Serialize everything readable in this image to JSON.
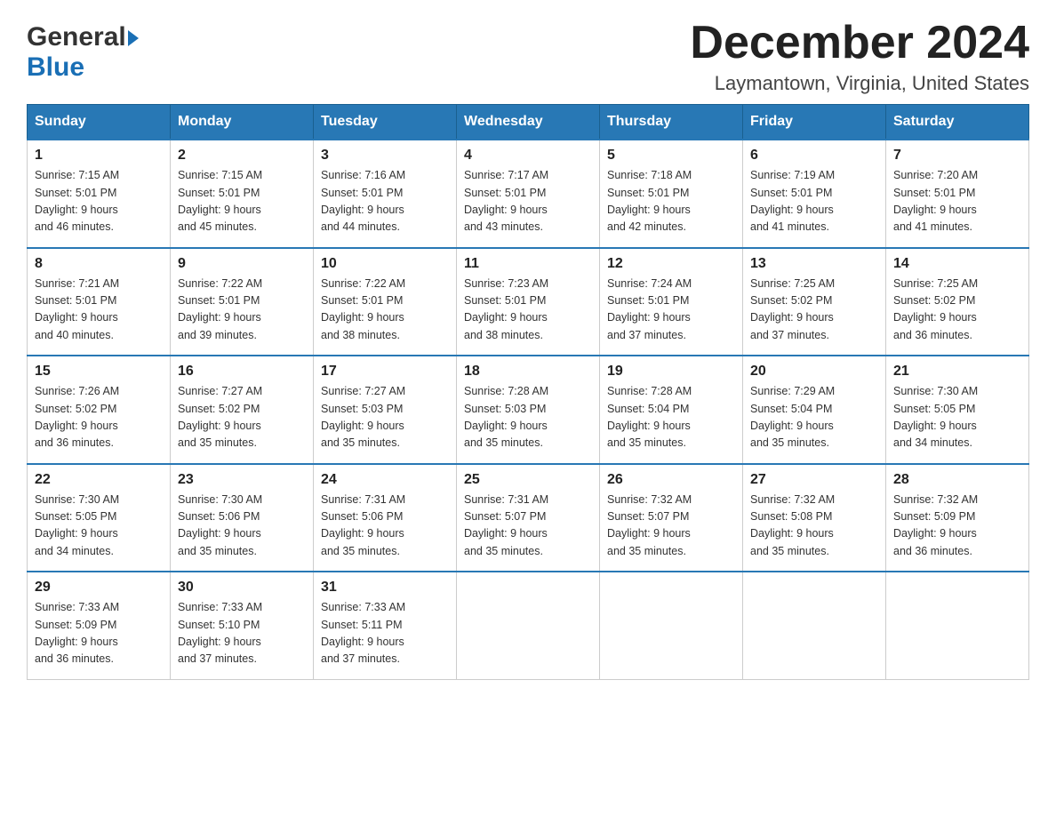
{
  "header": {
    "logo_general": "General",
    "logo_blue": "Blue",
    "month_title": "December 2024",
    "location": "Laymantown, Virginia, United States"
  },
  "days_of_week": [
    "Sunday",
    "Monday",
    "Tuesday",
    "Wednesday",
    "Thursday",
    "Friday",
    "Saturday"
  ],
  "weeks": [
    [
      {
        "day": "1",
        "sunrise": "7:15 AM",
        "sunset": "5:01 PM",
        "daylight": "9 hours and 46 minutes."
      },
      {
        "day": "2",
        "sunrise": "7:15 AM",
        "sunset": "5:01 PM",
        "daylight": "9 hours and 45 minutes."
      },
      {
        "day": "3",
        "sunrise": "7:16 AM",
        "sunset": "5:01 PM",
        "daylight": "9 hours and 44 minutes."
      },
      {
        "day": "4",
        "sunrise": "7:17 AM",
        "sunset": "5:01 PM",
        "daylight": "9 hours and 43 minutes."
      },
      {
        "day": "5",
        "sunrise": "7:18 AM",
        "sunset": "5:01 PM",
        "daylight": "9 hours and 42 minutes."
      },
      {
        "day": "6",
        "sunrise": "7:19 AM",
        "sunset": "5:01 PM",
        "daylight": "9 hours and 41 minutes."
      },
      {
        "day": "7",
        "sunrise": "7:20 AM",
        "sunset": "5:01 PM",
        "daylight": "9 hours and 41 minutes."
      }
    ],
    [
      {
        "day": "8",
        "sunrise": "7:21 AM",
        "sunset": "5:01 PM",
        "daylight": "9 hours and 40 minutes."
      },
      {
        "day": "9",
        "sunrise": "7:22 AM",
        "sunset": "5:01 PM",
        "daylight": "9 hours and 39 minutes."
      },
      {
        "day": "10",
        "sunrise": "7:22 AM",
        "sunset": "5:01 PM",
        "daylight": "9 hours and 38 minutes."
      },
      {
        "day": "11",
        "sunrise": "7:23 AM",
        "sunset": "5:01 PM",
        "daylight": "9 hours and 38 minutes."
      },
      {
        "day": "12",
        "sunrise": "7:24 AM",
        "sunset": "5:01 PM",
        "daylight": "9 hours and 37 minutes."
      },
      {
        "day": "13",
        "sunrise": "7:25 AM",
        "sunset": "5:02 PM",
        "daylight": "9 hours and 37 minutes."
      },
      {
        "day": "14",
        "sunrise": "7:25 AM",
        "sunset": "5:02 PM",
        "daylight": "9 hours and 36 minutes."
      }
    ],
    [
      {
        "day": "15",
        "sunrise": "7:26 AM",
        "sunset": "5:02 PM",
        "daylight": "9 hours and 36 minutes."
      },
      {
        "day": "16",
        "sunrise": "7:27 AM",
        "sunset": "5:02 PM",
        "daylight": "9 hours and 35 minutes."
      },
      {
        "day": "17",
        "sunrise": "7:27 AM",
        "sunset": "5:03 PM",
        "daylight": "9 hours and 35 minutes."
      },
      {
        "day": "18",
        "sunrise": "7:28 AM",
        "sunset": "5:03 PM",
        "daylight": "9 hours and 35 minutes."
      },
      {
        "day": "19",
        "sunrise": "7:28 AM",
        "sunset": "5:04 PM",
        "daylight": "9 hours and 35 minutes."
      },
      {
        "day": "20",
        "sunrise": "7:29 AM",
        "sunset": "5:04 PM",
        "daylight": "9 hours and 35 minutes."
      },
      {
        "day": "21",
        "sunrise": "7:30 AM",
        "sunset": "5:05 PM",
        "daylight": "9 hours and 34 minutes."
      }
    ],
    [
      {
        "day": "22",
        "sunrise": "7:30 AM",
        "sunset": "5:05 PM",
        "daylight": "9 hours and 34 minutes."
      },
      {
        "day": "23",
        "sunrise": "7:30 AM",
        "sunset": "5:06 PM",
        "daylight": "9 hours and 35 minutes."
      },
      {
        "day": "24",
        "sunrise": "7:31 AM",
        "sunset": "5:06 PM",
        "daylight": "9 hours and 35 minutes."
      },
      {
        "day": "25",
        "sunrise": "7:31 AM",
        "sunset": "5:07 PM",
        "daylight": "9 hours and 35 minutes."
      },
      {
        "day": "26",
        "sunrise": "7:32 AM",
        "sunset": "5:07 PM",
        "daylight": "9 hours and 35 minutes."
      },
      {
        "day": "27",
        "sunrise": "7:32 AM",
        "sunset": "5:08 PM",
        "daylight": "9 hours and 35 minutes."
      },
      {
        "day": "28",
        "sunrise": "7:32 AM",
        "sunset": "5:09 PM",
        "daylight": "9 hours and 36 minutes."
      }
    ],
    [
      {
        "day": "29",
        "sunrise": "7:33 AM",
        "sunset": "5:09 PM",
        "daylight": "9 hours and 36 minutes."
      },
      {
        "day": "30",
        "sunrise": "7:33 AM",
        "sunset": "5:10 PM",
        "daylight": "9 hours and 37 minutes."
      },
      {
        "day": "31",
        "sunrise": "7:33 AM",
        "sunset": "5:11 PM",
        "daylight": "9 hours and 37 minutes."
      },
      null,
      null,
      null,
      null
    ]
  ],
  "labels": {
    "sunrise_prefix": "Sunrise: ",
    "sunset_prefix": "Sunset: ",
    "daylight_prefix": "Daylight: "
  }
}
